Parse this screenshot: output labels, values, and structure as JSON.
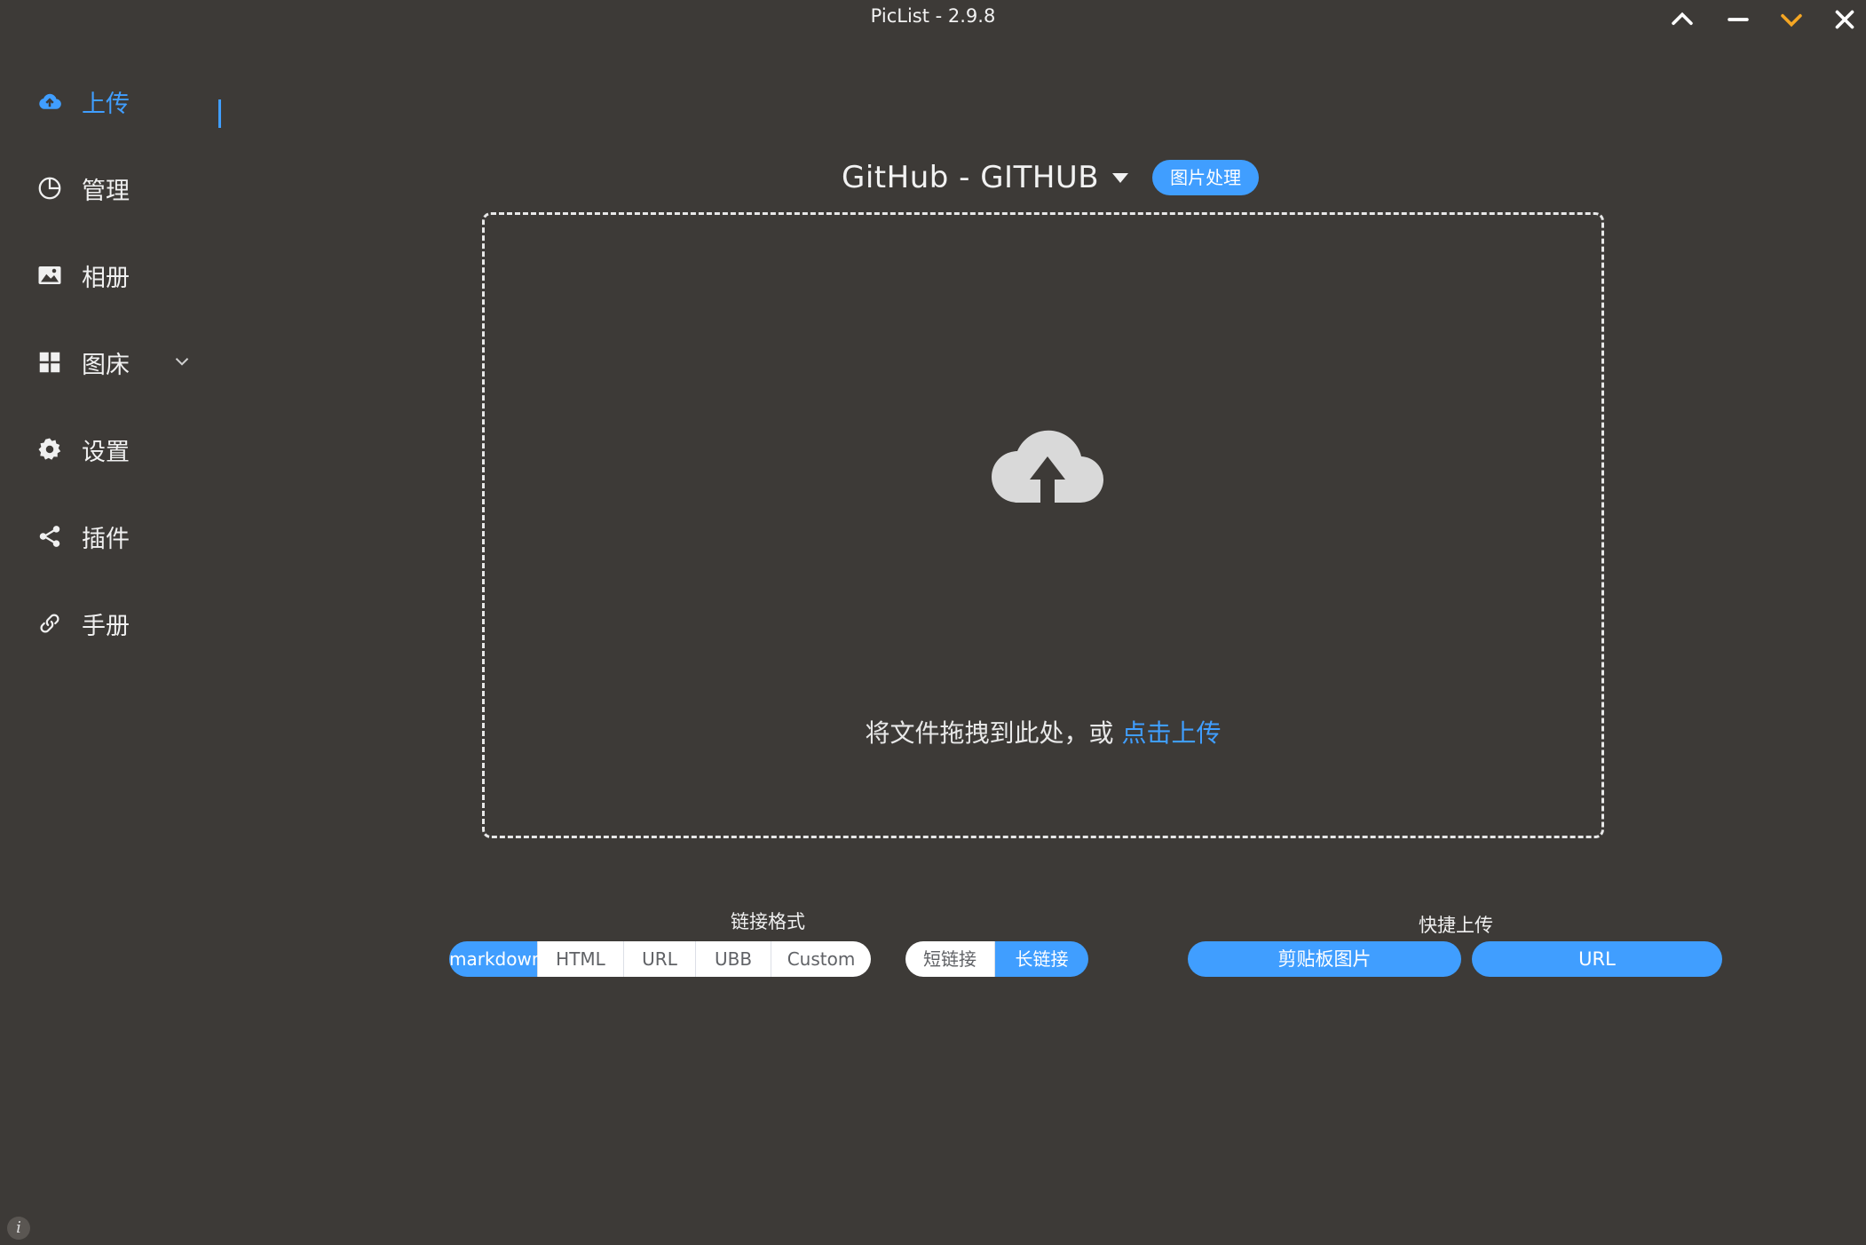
{
  "window": {
    "title": "PicList - 2.9.8"
  },
  "sidebar": {
    "items": [
      {
        "label": "上传",
        "icon": "cloud-upload-icon"
      },
      {
        "label": "管理",
        "icon": "pie-chart-icon"
      },
      {
        "label": "相册",
        "icon": "image-icon"
      },
      {
        "label": "图床",
        "icon": "grid-icon"
      },
      {
        "label": "设置",
        "icon": "gear-icon"
      },
      {
        "label": "插件",
        "icon": "share-icon"
      },
      {
        "label": "手册",
        "icon": "link-icon"
      }
    ],
    "info_glyph": "i"
  },
  "main": {
    "picbed_name": "GitHub - GITHUB",
    "image_process_label": "图片处理",
    "drop_text": "将文件拖拽到此处，或 ",
    "drop_link": "点击上传"
  },
  "link_format": {
    "label": "链接格式",
    "options": [
      "markdown",
      "HTML",
      "URL",
      "UBB",
      "Custom"
    ],
    "selected": "markdown",
    "length_options": [
      "短链接",
      "长链接"
    ],
    "length_selected": "长链接"
  },
  "quick_upload": {
    "label": "快捷上传",
    "clipboard_label": "剪贴板图片",
    "url_label": "URL"
  },
  "colors": {
    "accent": "#409eff",
    "background": "#3d3a37",
    "minimize_chevron": "#f5a623"
  }
}
